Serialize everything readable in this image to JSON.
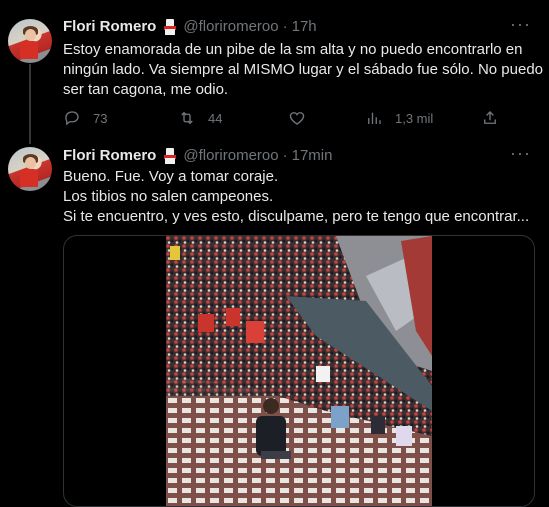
{
  "tweets": [
    {
      "name": "Flori Romero",
      "handle": "@floriromeroo",
      "separator": "·",
      "time": "17h",
      "text": "Estoy enamorada de un pibe de la sm alta y no puedo encontrarlo en ningún lado. Va siempre al MISMO lugar y el sábado fue sólo. No puedo ser tan cagona, me odio.",
      "replies": "73",
      "retweets": "44",
      "likes": "",
      "views": "1,3 mil"
    },
    {
      "name": "Flori Romero",
      "handle": "@floriromeroo",
      "separator": "·",
      "time": "17min",
      "lines": [
        "Bueno. Fue. Voy a tomar coraje.",
        "Los tibios no salen campeones.",
        "Si te encuentro, y ves esto, disculpame, pero te tengo que encontrar..."
      ]
    }
  ],
  "more_icon": "more-horizontal-icon",
  "icons": [
    "reply-icon",
    "retweet-icon",
    "like-icon",
    "views-icon",
    "share-icon"
  ]
}
